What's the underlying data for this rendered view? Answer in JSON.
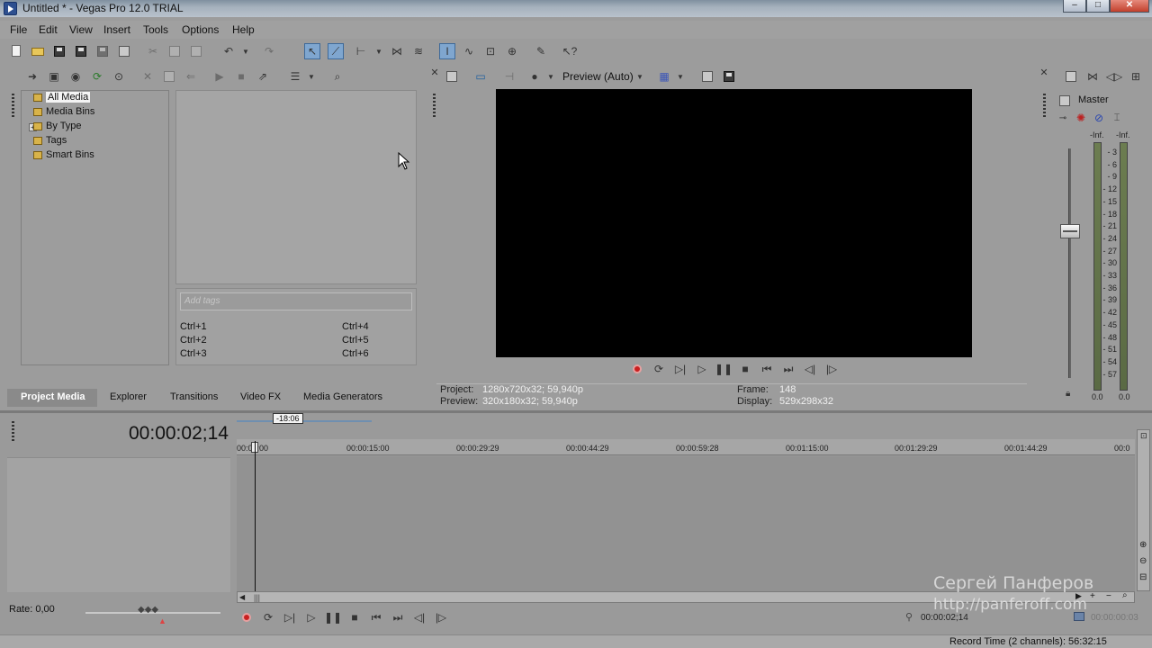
{
  "window": {
    "title": "Untitled * - Vegas Pro 12.0 TRIAL",
    "minimize": "–",
    "maximize": "□",
    "close": "✕"
  },
  "menu": [
    "File",
    "Edit",
    "View",
    "Insert",
    "Tools",
    "Options",
    "Help"
  ],
  "media_tree": {
    "items": [
      {
        "label": "All Media",
        "selected": true
      },
      {
        "label": "Media Bins"
      },
      {
        "label": "By Type",
        "expandable": true
      },
      {
        "label": "Tags"
      },
      {
        "label": "Smart Bins"
      }
    ]
  },
  "tags": {
    "placeholder": "Add tags",
    "shortcuts": [
      "Ctrl+1",
      "Ctrl+2",
      "Ctrl+3",
      "Ctrl+4",
      "Ctrl+5",
      "Ctrl+6"
    ]
  },
  "tabs": [
    "Project Media",
    "Explorer",
    "Transitions",
    "Video FX",
    "Media Generators"
  ],
  "preview": {
    "quality": "Preview (Auto)",
    "project_label": "Project:",
    "project_value": "1280x720x32; 59,940p",
    "preview_label": "Preview:",
    "preview_value": "320x180x32; 59,940p",
    "frame_label": "Frame:",
    "frame_value": "148",
    "display_label": "Display:",
    "display_value": "529x298x32"
  },
  "master": {
    "label": "Master",
    "peak_left": "-Inf.",
    "peak_right": "-Inf.",
    "scale": [
      "3",
      "6",
      "9",
      "12",
      "15",
      "18",
      "21",
      "24",
      "27",
      "30",
      "33",
      "36",
      "39",
      "42",
      "45",
      "48",
      "51",
      "54",
      "57"
    ],
    "bottom_left": "0.0",
    "bottom_right": "0.0"
  },
  "timeline": {
    "timecode": "00:00:02;14",
    "loop_label": "-18:06",
    "ruler": [
      "00:00:00",
      "00:00:15:00",
      "00:00:29:29",
      "00:00:44:29",
      "00:00:59:28",
      "00:01:15:00",
      "00:01:29:29",
      "00:01:44:29",
      "00:0"
    ],
    "rate": "Rate: 0,00",
    "cursor_time": "00:00:02;14",
    "selection_time": "00:00:00:03"
  },
  "status": {
    "record_time": "Record Time (2 channels): 56:32:15"
  },
  "watermark": {
    "name": "Сергей Панферов",
    "url": "http://panferoff.com"
  },
  "colors": {
    "background": "#9c9c9c",
    "record_red": "#c92020",
    "meter_green": "#6c7d50"
  }
}
